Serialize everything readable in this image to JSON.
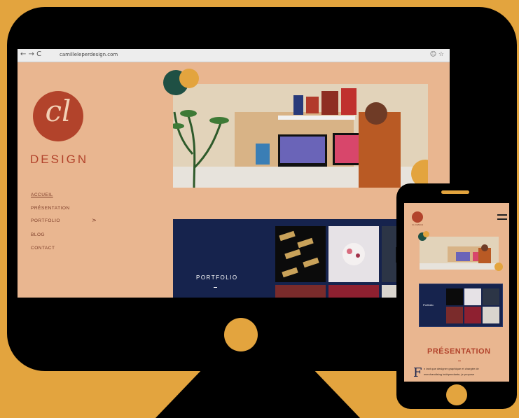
{
  "browser": {
    "nav": "← → C",
    "url": "camilleleperdesign.com",
    "icons_right": "☺ ☆"
  },
  "logo": {
    "initials": "cl",
    "word": "DESIGN"
  },
  "menu": [
    {
      "label": "ACCUEIL",
      "active": true
    },
    {
      "label": "PRÉSENTATION",
      "active": false
    },
    {
      "label": "PORTFOLIO",
      "active": false,
      "chevron": ">"
    },
    {
      "label": "BLOG",
      "active": false
    },
    {
      "label": "CONTACT",
      "active": false
    }
  ],
  "portfolio": {
    "label": "PORTFOLIO",
    "dash": "–"
  },
  "phone": {
    "logo_text": "CL DESIGN",
    "portfolio_label": "Portfolio",
    "presentation_title": "PRÉSENTATION",
    "drop_cap": "F",
    "body_line1": "n tant que designer graphique et chargée de",
    "body_line2": "merchandising indépendante, je propose"
  },
  "colors": {
    "background": "#E3A43E",
    "page": "#E9B690",
    "brand": "#B2432B",
    "navy": "#16234D",
    "green": "#1F5044"
  }
}
